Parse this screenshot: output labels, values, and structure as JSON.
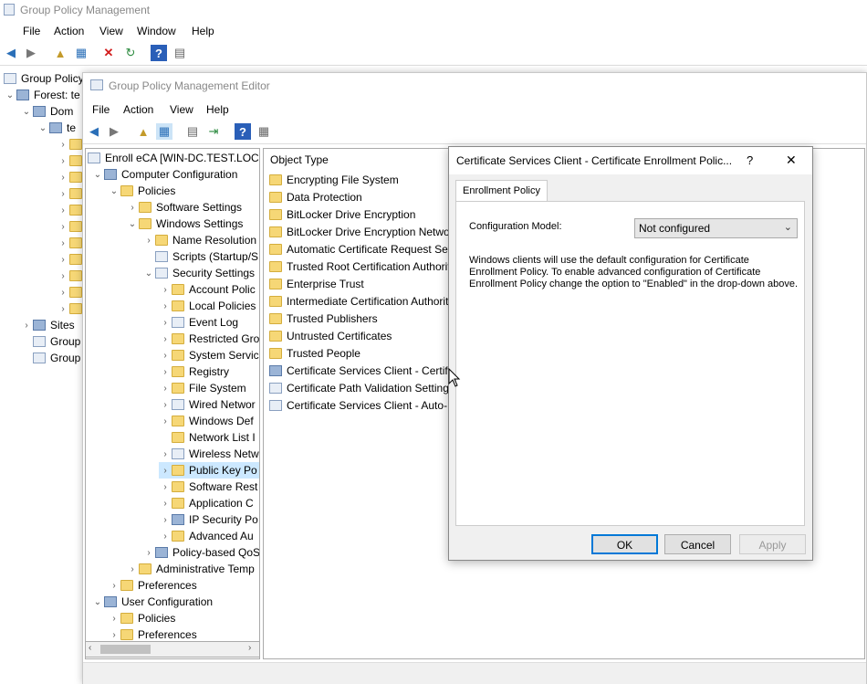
{
  "outer": {
    "title": "Group Policy Management",
    "menu": [
      "File",
      "Action",
      "View",
      "Window",
      "Help"
    ],
    "tree": [
      {
        "label": "Group Policy",
        "indent": 0
      },
      {
        "label": "Forest: te",
        "indent": 1
      },
      {
        "label": "Dom",
        "indent": 2
      },
      {
        "label": "te",
        "indent": 3
      },
      {
        "label": "Sites",
        "indent": 1
      },
      {
        "label": "Group",
        "indent": 1
      },
      {
        "label": "Group",
        "indent": 1
      }
    ]
  },
  "editor": {
    "title": "Group Policy Management Editor",
    "menu": [
      "File",
      "Action",
      "View",
      "Help"
    ],
    "tree": [
      {
        "label": "Enroll eCA [WIN-DC.TEST.LOCA",
        "icon": "doc"
      },
      {
        "label": "Computer Configuration",
        "icon": "gear"
      },
      {
        "label": "Policies",
        "icon": "folder"
      },
      {
        "label": "Software Settings",
        "icon": "folder"
      },
      {
        "label": "Windows Settings",
        "icon": "folder"
      },
      {
        "label": "Name Resolution",
        "icon": "folder"
      },
      {
        "label": "Scripts (Startup/S",
        "icon": "doc"
      },
      {
        "label": "Security Settings",
        "icon": "doc"
      },
      {
        "label": "Account Polic",
        "icon": "folder"
      },
      {
        "label": "Local Policies",
        "icon": "folder"
      },
      {
        "label": "Event Log",
        "icon": "doc"
      },
      {
        "label": "Restricted Gro",
        "icon": "folder"
      },
      {
        "label": "System Servic",
        "icon": "folder"
      },
      {
        "label": "Registry",
        "icon": "folder"
      },
      {
        "label": "File System",
        "icon": "folder"
      },
      {
        "label": "Wired Networ",
        "icon": "doc"
      },
      {
        "label": "Windows Def",
        "icon": "folder"
      },
      {
        "label": "Network List I",
        "icon": "folder"
      },
      {
        "label": "Wireless Netw",
        "icon": "doc"
      },
      {
        "label": "Public Key Po",
        "icon": "folder"
      },
      {
        "label": "Software Rest",
        "icon": "folder"
      },
      {
        "label": "Application C",
        "icon": "folder"
      },
      {
        "label": "IP Security Po",
        "icon": "gear"
      },
      {
        "label": "Advanced Au",
        "icon": "folder"
      },
      {
        "label": "Policy-based QoS",
        "icon": "gear"
      },
      {
        "label": "Administrative Temp",
        "icon": "folder"
      },
      {
        "label": "Preferences",
        "icon": "folder"
      },
      {
        "label": "User Configuration",
        "icon": "gear"
      },
      {
        "label": "Policies",
        "icon": "folder"
      },
      {
        "label": "Preferences",
        "icon": "folder"
      }
    ],
    "list_header": "Object Type",
    "list": [
      "Encrypting File System",
      "Data Protection",
      "BitLocker Drive Encryption",
      "BitLocker Drive Encryption Network Unlock Certificate",
      "Automatic Certificate Request Settings",
      "Trusted Root Certification Authorities",
      "Enterprise Trust",
      "Intermediate Certification Authorities",
      "Trusted Publishers",
      "Untrusted Certificates",
      "Trusted People",
      "Certificate Services Client - Certificate Enrollment Policy",
      "Certificate Path Validation Settings",
      "Certificate Services Client - Auto-Enrollment"
    ]
  },
  "dialog": {
    "title": "Certificate Services Client - Certificate Enrollment Polic...",
    "help": "?",
    "close": "✕",
    "tab": "Enrollment Policy",
    "config_label": "Configuration Model:",
    "config_value": "Not configured",
    "description": "Windows clients will use the default configuration for Certificate Enrollment Policy. To enable advanced configuration of Certificate Enrollment Policy change the option to \"Enabled\" in the drop-down above.",
    "ok": "OK",
    "cancel": "Cancel",
    "apply": "Apply"
  }
}
